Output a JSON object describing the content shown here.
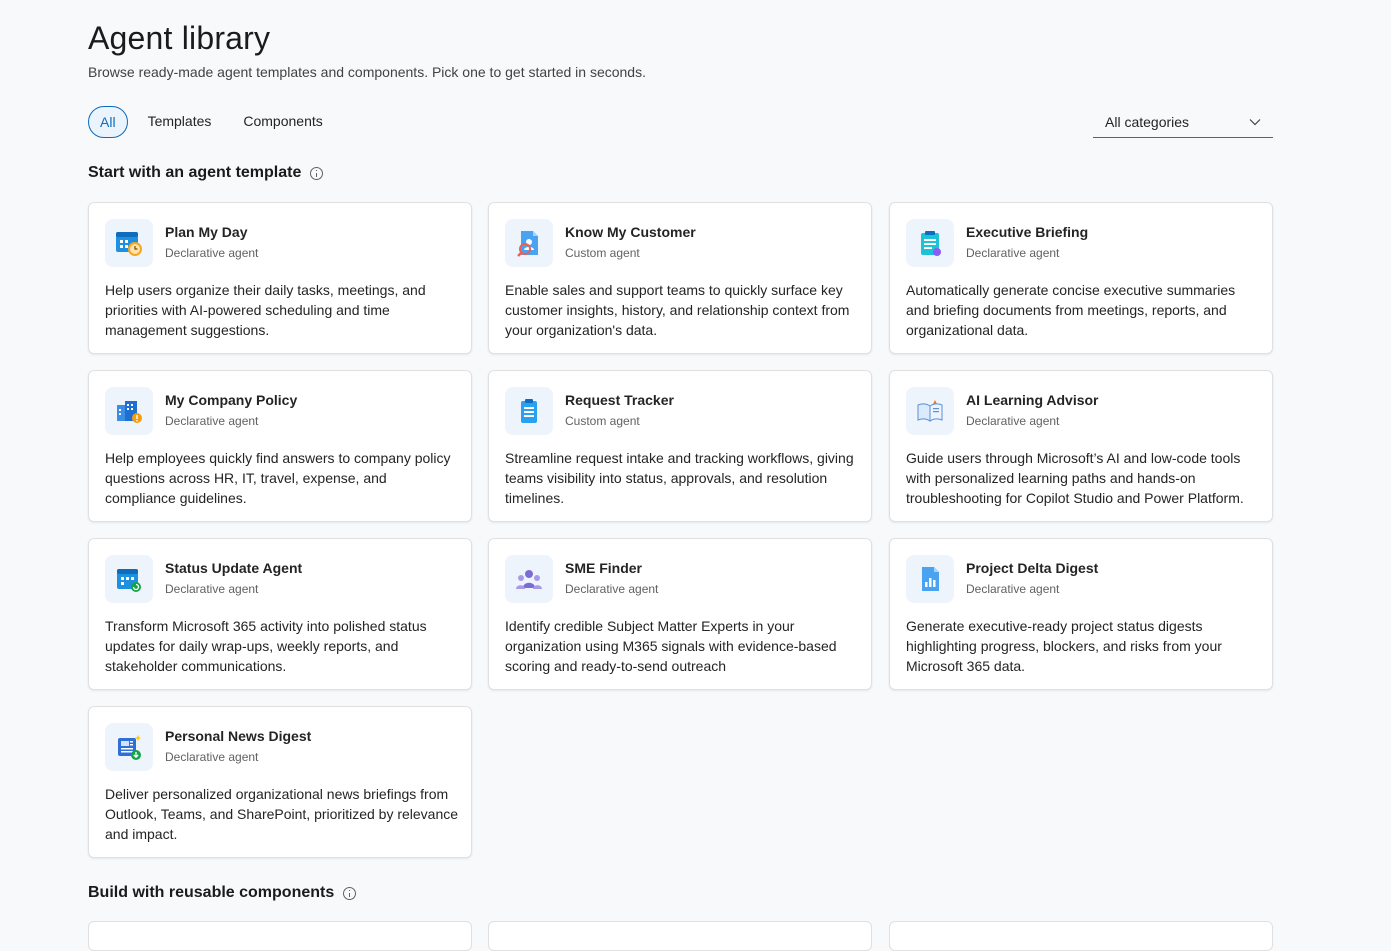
{
  "header": {
    "title": "Agent library",
    "subtitle": "Browse ready-made agent templates and components. Pick one to get started in seconds."
  },
  "tabs": [
    {
      "label": "All",
      "active": true
    },
    {
      "label": "Templates",
      "active": false
    },
    {
      "label": "Components",
      "active": false
    }
  ],
  "filter": {
    "selected": "All categories"
  },
  "sections": {
    "templates": "Start with an agent template",
    "components": "Build with reusable components"
  },
  "cards": [
    {
      "name": "Plan My Day",
      "kind": "Declarative agent",
      "icon": "calendar-clock-icon",
      "description": "Help users organize their daily tasks, meetings, and priorities with AI-powered scheduling and time management suggestions."
    },
    {
      "name": "Know My Customer",
      "kind": "Custom agent",
      "icon": "customer-search-icon",
      "description": "Enable sales and support teams to quickly surface key customer insights, history, and relationship context from your organization's data."
    },
    {
      "name": "Executive Briefing",
      "kind": "Declarative agent",
      "icon": "clipboard-briefing-icon",
      "description": "Automatically generate concise executive summaries and briefing documents from meetings, reports, and organizational data."
    },
    {
      "name": "My Company Policy",
      "kind": "Declarative agent",
      "icon": "building-policy-icon",
      "description": "Help employees quickly find answers to company policy questions across HR, IT, travel, expense, and compliance guidelines."
    },
    {
      "name": "Request Tracker",
      "kind": "Custom agent",
      "icon": "clipboard-list-icon",
      "description": "Streamline request intake and tracking workflows, giving teams visibility into status, approvals, and resolution timelines."
    },
    {
      "name": "AI Learning Advisor",
      "kind": "Declarative agent",
      "icon": "open-book-icon",
      "description": "Guide users through Microsoft’s AI and low-code tools with personalized learning paths and hands-on troubleshooting for Copilot Studio and Power Platform."
    },
    {
      "name": "Status Update Agent",
      "kind": "Declarative agent",
      "icon": "calendar-refresh-icon",
      "description": "Transform Microsoft 365 activity into polished status updates for daily wrap-ups, weekly reports, and stakeholder communications."
    },
    {
      "name": "SME Finder",
      "kind": "Declarative agent",
      "icon": "people-group-icon",
      "description": "Identify credible Subject Matter Experts in your organization using M365 signals with evidence-based scoring and ready-to-send outreach"
    },
    {
      "name": "Project Delta Digest",
      "kind": "Declarative agent",
      "icon": "document-chart-icon",
      "description": "Generate executive-ready project status digests highlighting progress, blockers, and risks from your Microsoft 365 data."
    },
    {
      "name": "Personal News Digest",
      "kind": "Declarative agent",
      "icon": "news-download-icon",
      "description": "Deliver personalized organizational news briefings from Outlook, Teams, and SharePoint, prioritized by relevance and impact."
    }
  ],
  "colors": {
    "accent": "#0f6cbd",
    "accent_bg": "#ebf3fc",
    "page_bg": "#f7f9fb"
  }
}
